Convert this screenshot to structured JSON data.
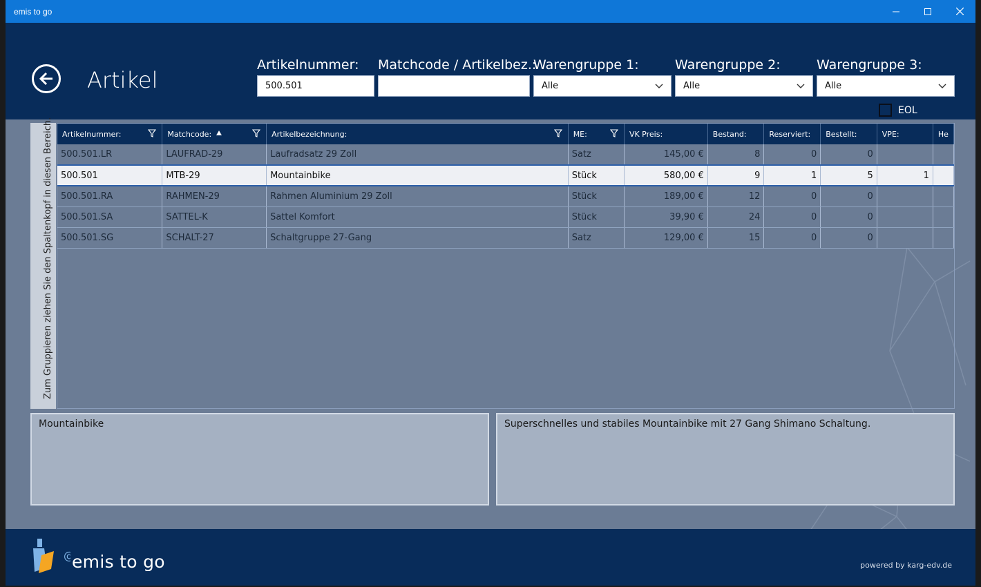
{
  "window": {
    "title": "emis to go"
  },
  "header": {
    "title": "Artikel",
    "filters": {
      "artikelnummer": {
        "label": "Artikelnummer:",
        "value": "500.501"
      },
      "matchcode": {
        "label": "Matchcode / Artikelbez.:",
        "value": ""
      },
      "warengruppe1": {
        "label": "Warengruppe 1:",
        "value": "Alle"
      },
      "warengruppe2": {
        "label": "Warengruppe 2:",
        "value": "Alle"
      },
      "warengruppe3": {
        "label": "Warengruppe 3:",
        "value": "Alle"
      }
    },
    "eol": {
      "label": "EOL",
      "checked": false
    }
  },
  "group_panel": {
    "text": "Zum Gruppieren ziehen Sie den Spaltenkopf in diesen Bereich."
  },
  "grid": {
    "columns": [
      "Artikelnummer:",
      "Matchcode:",
      "Artikelbezeichnung:",
      "ME:",
      "VK Preis:",
      "Bestand:",
      "Reserviert:",
      "Bestellt:",
      "VPE:",
      "He"
    ],
    "rows": [
      {
        "artikelnummer": "500.501.LR",
        "matchcode": "LAUFRAD-29",
        "bezeichnung": "Laufradsatz 29 Zoll",
        "me": "Satz",
        "vk": "145,00 €",
        "bestand": "8",
        "reserviert": "0",
        "bestellt": "0",
        "vpe": ""
      },
      {
        "artikelnummer": "500.501",
        "matchcode": "MTB-29",
        "bezeichnung": "Mountainbike",
        "me": "Stück",
        "vk": "580,00 €",
        "bestand": "9",
        "reserviert": "1",
        "bestellt": "5",
        "vpe": "1"
      },
      {
        "artikelnummer": "500.501.RA",
        "matchcode": "RAHMEN-29",
        "bezeichnung": "Rahmen Aluminium 29 Zoll",
        "me": "Stück",
        "vk": "189,00 €",
        "bestand": "12",
        "reserviert": "0",
        "bestellt": "0",
        "vpe": ""
      },
      {
        "artikelnummer": "500.501.SA",
        "matchcode": "SATTEL-K",
        "bezeichnung": "Sattel Komfort",
        "me": "Stück",
        "vk": "39,90 €",
        "bestand": "24",
        "reserviert": "0",
        "bestellt": "0",
        "vpe": ""
      },
      {
        "artikelnummer": "500.501.SG",
        "matchcode": "SCHALT-27",
        "bezeichnung": "Schaltgruppe 27-Gang",
        "me": "Satz",
        "vk": "129,00 €",
        "bestand": "15",
        "reserviert": "0",
        "bestellt": "0",
        "vpe": ""
      }
    ],
    "selected_row": 1
  },
  "details": {
    "short_text": "Mountainbike",
    "long_text": "Superschnelles und stabiles Mountainbike mit 27 Gang Shimano Schaltung."
  },
  "footer": {
    "brand": "emis to go",
    "powered": "powered by karg-edv.de"
  },
  "colors": {
    "titlebar": "#0f77d8",
    "header": "#082c5a",
    "content": "#6b7c95",
    "selected_row": "#eef0f4"
  }
}
